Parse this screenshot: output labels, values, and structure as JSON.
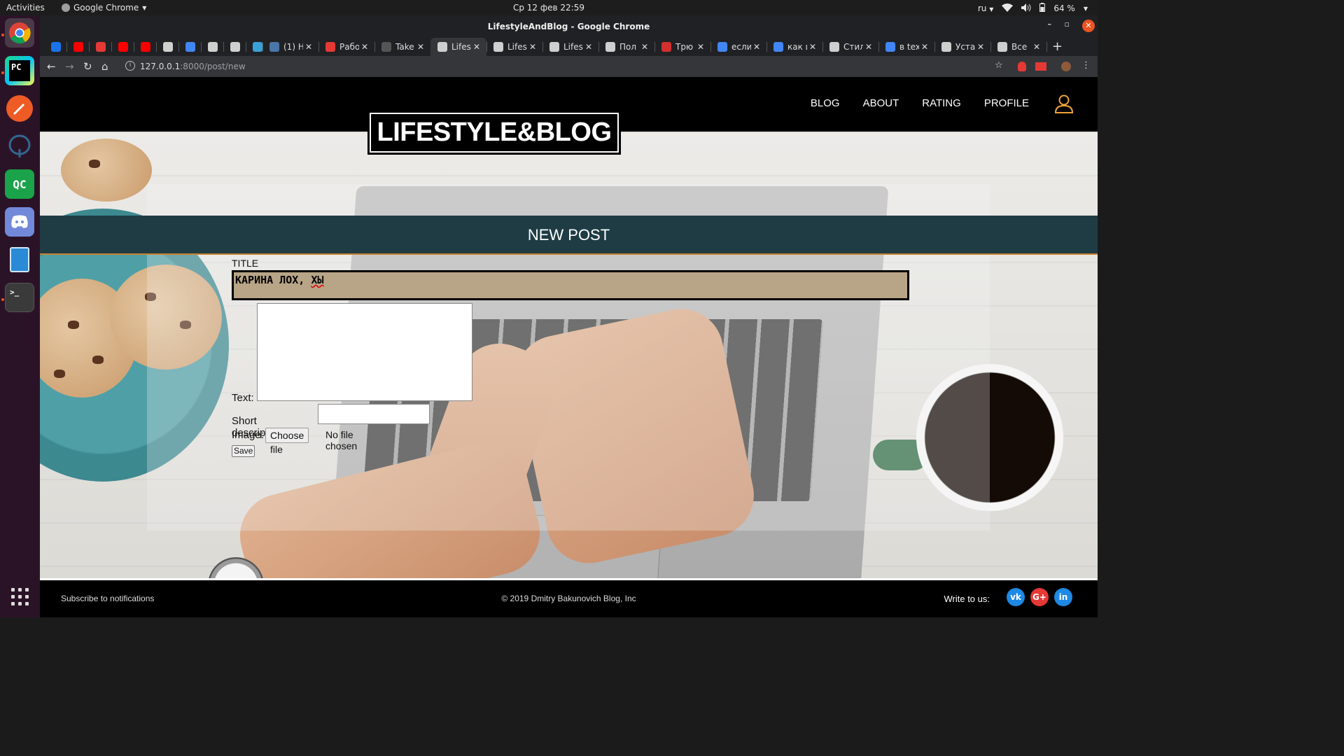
{
  "os": {
    "activities": "Activities",
    "app_menu": "Google Chrome",
    "clock": "Ср 12 фев  22:59",
    "keyboard_layout": "ru",
    "battery": "64 %"
  },
  "window": {
    "title": "LifestyleAndBlog - Google Chrome"
  },
  "tabs": [
    {
      "label": "",
      "icon": "app-icon",
      "color": "#1a73e8"
    },
    {
      "label": "",
      "icon": "youtube-icon",
      "color": "#ff0000"
    },
    {
      "label": "",
      "icon": "bookmark-icon",
      "color": "#e53935"
    },
    {
      "label": "",
      "icon": "youtube-icon",
      "color": "#ff0000"
    },
    {
      "label": "",
      "icon": "youtube-icon",
      "color": "#ff0000"
    },
    {
      "label": "",
      "icon": "grid-icon",
      "color": "#cfcfcf"
    },
    {
      "label": "",
      "icon": "google-icon",
      "color": "#4285f4"
    },
    {
      "label": "",
      "icon": "calendar-icon",
      "color": "#cfcfcf"
    },
    {
      "label": "",
      "icon": "globe-icon",
      "color": "#cfcfcf"
    },
    {
      "label": "",
      "icon": "app-icon",
      "color": "#3aa0d8"
    },
    {
      "label": "(1) Н",
      "icon": "vk-icon",
      "color": "#4a76a8"
    },
    {
      "label": "Рабо",
      "icon": "bookmark-icon",
      "color": "#e53935"
    },
    {
      "label": "Take",
      "icon": "ef-icon",
      "color": "#555"
    },
    {
      "label": "Lifes",
      "icon": "globe-icon",
      "color": "#cfcfcf",
      "active": true
    },
    {
      "label": "Lifes",
      "icon": "globe-icon",
      "color": "#cfcfcf"
    },
    {
      "label": "Lifes",
      "icon": "globe-icon",
      "color": "#cfcfcf"
    },
    {
      "label": "Пол",
      "icon": "app-icon",
      "color": "#cfcfcf"
    },
    {
      "label": "Трю",
      "icon": "v-icon",
      "color": "#d32f2f"
    },
    {
      "label": "если",
      "icon": "google-icon",
      "color": "#4285f4"
    },
    {
      "label": "как и",
      "icon": "google-icon",
      "color": "#4285f4"
    },
    {
      "label": "Стил",
      "icon": "globe-icon",
      "color": "#cfcfcf"
    },
    {
      "label": "в tex",
      "icon": "google-icon",
      "color": "#4285f4"
    },
    {
      "label": "Уста",
      "icon": "app-icon",
      "color": "#cfcfcf"
    },
    {
      "label": "Все",
      "icon": "app-icon",
      "color": "#cfcfcf"
    }
  ],
  "address": {
    "host": "127.0.0.1",
    "rest": ":8000/post/new"
  },
  "site": {
    "logo": "LIFESTYLE&BLOG",
    "nav": [
      "BLOG",
      "ABOUT",
      "RATING",
      "PROFILE"
    ],
    "section_title": "NEW POST"
  },
  "form": {
    "title_label": "TITLE",
    "title_value_plain": "КАРИНА ЛОХ, ",
    "title_value_flagged": "ХЫ",
    "text_label": "Text:",
    "short_label": "Short description:",
    "image_label": "Image:",
    "choose_file": "Choose file",
    "no_file": "No file chosen",
    "save": "Save"
  },
  "footer": {
    "subscribe": "Subscribe to notifications",
    "copyright": "© 2019 Dmitry Bakunovich Blog, Inc",
    "write_to_us": "Write to us:",
    "social": [
      {
        "label": "vk",
        "color": "#1e88e5"
      },
      {
        "label": "G+",
        "color": "#e53935"
      },
      {
        "label": "in",
        "color": "#1e88e5"
      }
    ]
  },
  "colors": {
    "accent": "#e95420",
    "section_bar": "#1f3c45",
    "title_input": "#b8a587"
  }
}
